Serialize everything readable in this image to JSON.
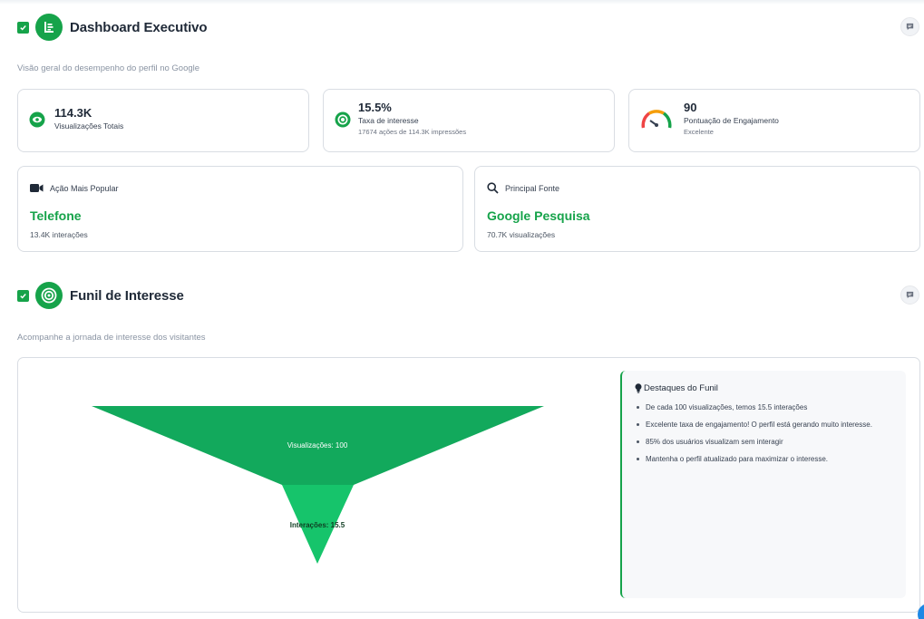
{
  "dashboard": {
    "title": "Dashboard Executivo",
    "subtitle": "Visão geral do desempenho do perfil no Google",
    "stats": {
      "views": {
        "value": "114.3K",
        "label": "Visualizações Totais"
      },
      "interest": {
        "value": "15.5%",
        "label": "Taxa de interesse",
        "sub": "17674 ações de 114.3K impressões"
      },
      "engagement": {
        "value": "90",
        "label": "Pontuação de Engajamento",
        "sub": "Excelente",
        "score": 90
      }
    },
    "popular_action": {
      "label": "Ação Mais Popular",
      "value": "Telefone",
      "sub": "13.4K interações"
    },
    "top_source": {
      "label": "Principal Fonte",
      "value": "Google Pesquisa",
      "sub": "70.7K visualizações"
    }
  },
  "funnel": {
    "title": "Funil de Interesse",
    "subtitle": "Acompanhe a jornada de interesse dos visitantes",
    "stage1_label": "Visualizações: 100",
    "stage2_label": "Interações: 15.5",
    "highlights": {
      "title": "Destaques do Funil",
      "items": [
        "De cada 100 visualizações, temos 15.5 interações",
        "Excelente taxa de engajamento! O perfil está gerando muito interesse.",
        "85% dos usuários visualizam sem interagir",
        "Mantenha o perfil atualizado para maximizar o interesse."
      ]
    }
  },
  "colors": {
    "accent": "#16a34a",
    "funnel_top": "#12a95c",
    "funnel_bottom": "#16c46b"
  }
}
